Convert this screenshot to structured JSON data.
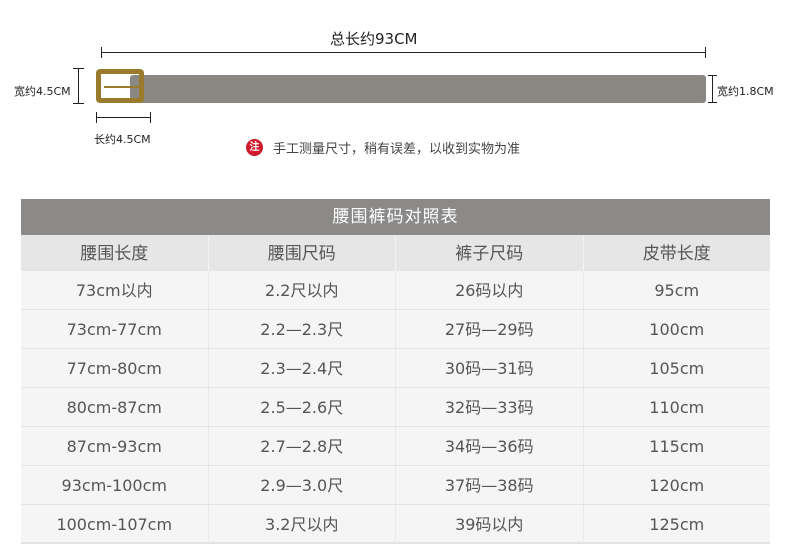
{
  "diagram": {
    "total_length_label": "总长约93CM",
    "buckle_width_label": "宽约4.5CM",
    "buckle_length_label": "长约4.5CM",
    "strap_width_label": "宽约1.8CM",
    "note_icon": "注",
    "note_text": "手工测量尺寸，稍有误差，以收到实物为准",
    "colors": {
      "buckle": "#9a7a2c",
      "strap": "#8b8884",
      "note_icon": "#d0192a"
    }
  },
  "size_table": {
    "title": "腰围裤码对照表",
    "headers": [
      "腰围长度",
      "腰围尺码",
      "裤子尺码",
      "皮带长度"
    ],
    "rows": [
      [
        "73cm以内",
        "2.2尺以内",
        "26码以内",
        "95cm"
      ],
      [
        "73cm-77cm",
        "2.2—2.3尺",
        "27码—29码",
        "100cm"
      ],
      [
        "77cm-80cm",
        "2.3—2.4尺",
        "30码—31码",
        "105cm"
      ],
      [
        "80cm-87cm",
        "2.5—2.6尺",
        "32码—33码",
        "110cm"
      ],
      [
        "87cm-93cm",
        "2.7—2.8尺",
        "34码—36码",
        "115cm"
      ],
      [
        "93cm-100cm",
        "2.9—3.0尺",
        "37码—38码",
        "120cm"
      ],
      [
        "100cm-107cm",
        "3.2尺以内",
        "39码以内",
        "125cm"
      ]
    ],
    "colors": {
      "title_bg": "#8b8a89",
      "header_bg": "#e6e6e6",
      "body_bg": "#f5f5f5"
    }
  }
}
